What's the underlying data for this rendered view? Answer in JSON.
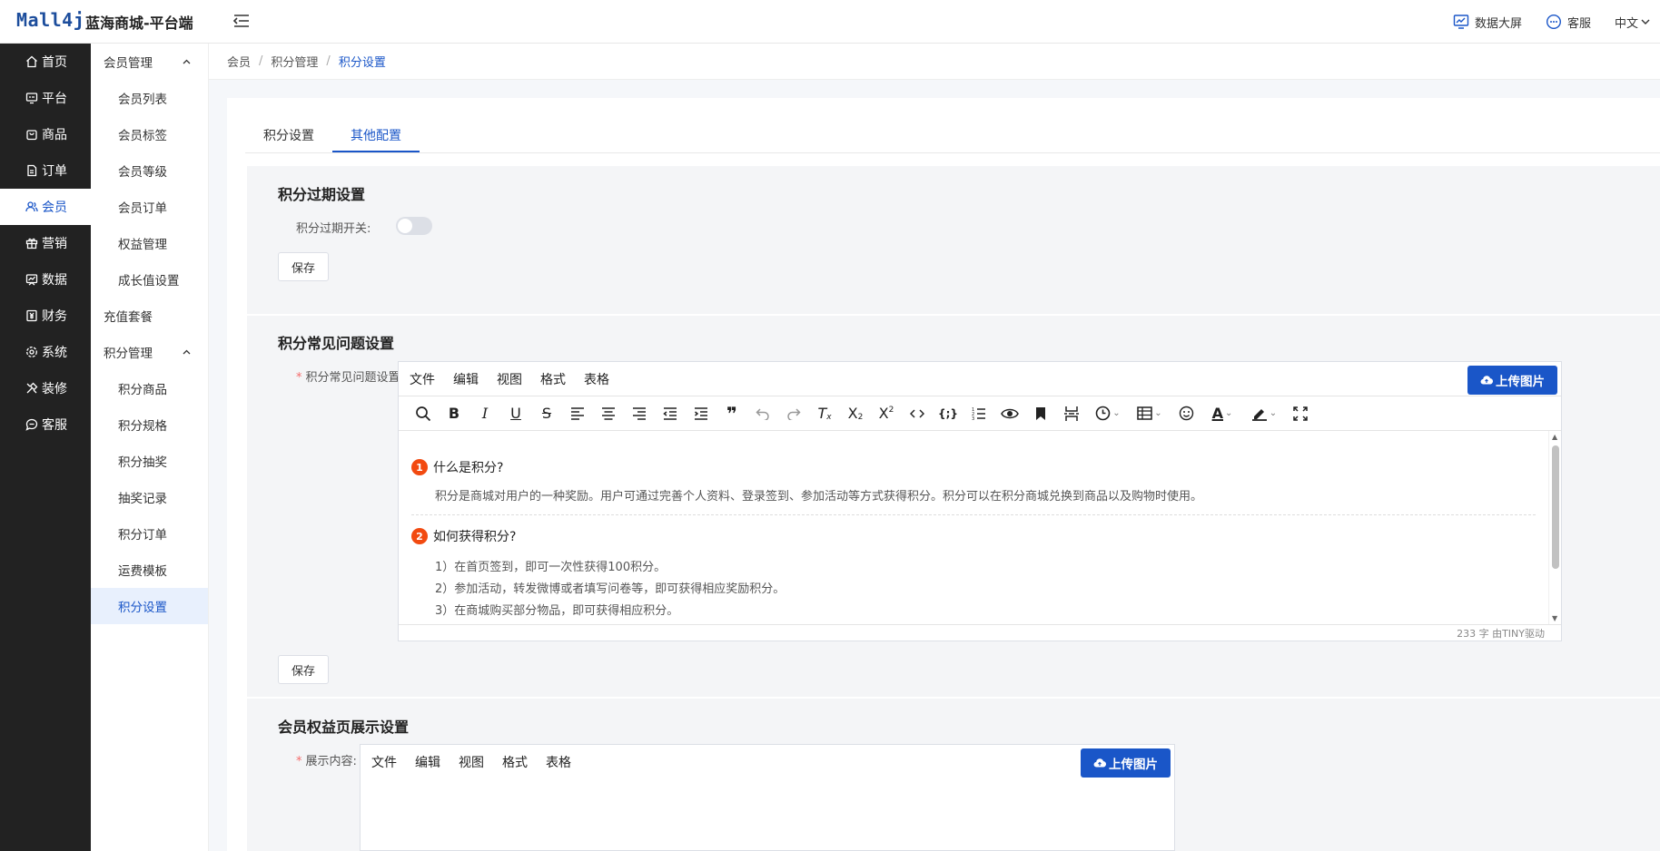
{
  "header": {
    "logo": "Mall4j",
    "title": "蓝海商城-平台端",
    "data_screen": "数据大屏",
    "service": "客服",
    "language": "中文"
  },
  "sidebar": {
    "items": [
      {
        "label": "首页",
        "icon": "home-icon"
      },
      {
        "label": "平台",
        "icon": "monitor-icon"
      },
      {
        "label": "商品",
        "icon": "bag-icon"
      },
      {
        "label": "订单",
        "icon": "document-icon"
      },
      {
        "label": "会员",
        "icon": "users-icon",
        "active": true
      },
      {
        "label": "营销",
        "icon": "gift-icon"
      },
      {
        "label": "数据",
        "icon": "chart-icon"
      },
      {
        "label": "财务",
        "icon": "finance-icon"
      },
      {
        "label": "系统",
        "icon": "gear-icon"
      },
      {
        "label": "装修",
        "icon": "decorate-icon"
      },
      {
        "label": "客服",
        "icon": "chat-icon"
      }
    ]
  },
  "subnav": {
    "items": [
      {
        "label": "会员管理",
        "type": "group"
      },
      {
        "label": "会员列表",
        "type": "child"
      },
      {
        "label": "会员标签",
        "type": "child"
      },
      {
        "label": "会员等级",
        "type": "child"
      },
      {
        "label": "会员订单",
        "type": "child"
      },
      {
        "label": "权益管理",
        "type": "child"
      },
      {
        "label": "成长值设置",
        "type": "child"
      },
      {
        "label": "充值套餐",
        "type": "top"
      },
      {
        "label": "积分管理",
        "type": "group"
      },
      {
        "label": "积分商品",
        "type": "child"
      },
      {
        "label": "积分规格",
        "type": "child"
      },
      {
        "label": "积分抽奖",
        "type": "child"
      },
      {
        "label": "抽奖记录",
        "type": "child"
      },
      {
        "label": "积分订单",
        "type": "child"
      },
      {
        "label": "运费模板",
        "type": "child"
      },
      {
        "label": "积分设置",
        "type": "child",
        "active": true
      }
    ]
  },
  "breadcrumb": [
    "会员",
    "积分管理",
    "积分设置"
  ],
  "tabs": [
    "积分设置",
    "其他配置"
  ],
  "expire_section": {
    "title": "积分过期设置",
    "switch_label": "积分过期开关:",
    "save": "保存"
  },
  "faq_section": {
    "title": "积分常见问题设置",
    "label": "积分常见问题设置",
    "save": "保存",
    "editor": {
      "menus": [
        "文件",
        "编辑",
        "视图",
        "格式",
        "表格"
      ],
      "upload": "上传图片",
      "q1_num": "1",
      "q1_title": "什么是积分?",
      "q1_text": "积分是商城对用户的一种奖励。用户可通过完善个人资料、登录签到、参加活动等方式获得积分。积分可以在积分商城兑换到商品以及购物时使用。",
      "q2_num": "2",
      "q2_title": "如何获得积分?",
      "q2_lines": [
        "1）在首页签到，即可一次性获得100积分。",
        "2）参加活动，转发微博或者填写问卷等，即可获得相应奖励积分。",
        "3）在商城购买部分物品，即可获得相应积分。"
      ],
      "status": "233 字  由TINY驱动"
    }
  },
  "benefit_section": {
    "title": "会员权益页展示设置",
    "label": "展示内容:",
    "menus": [
      "文件",
      "编辑",
      "视图",
      "格式",
      "表格"
    ],
    "upload": "上传图片"
  },
  "colors": {
    "primary": "#1a56c8",
    "sidebar_bg": "#222222",
    "badge": "#f24a10"
  }
}
